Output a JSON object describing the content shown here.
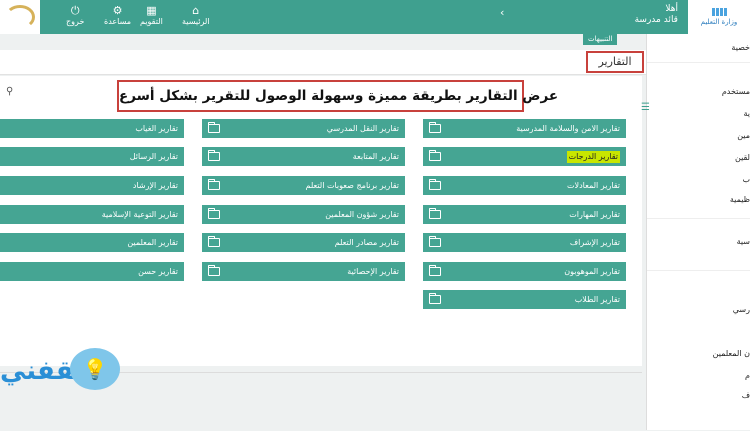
{
  "header": {
    "greeting": "أهلا",
    "user_role": "قائد مدرسة",
    "ministry_logo_text": "وزارة التعليم",
    "nav": [
      {
        "label": "الرئيسية",
        "icon": "home-icon"
      },
      {
        "label": "التقويم",
        "icon": "calendar-icon"
      },
      {
        "label": "مساعدة",
        "icon": "gear-icon"
      },
      {
        "label": "خروج",
        "icon": "power-icon"
      }
    ]
  },
  "notifications_label": "التنبيهات",
  "page_title": "التقارير",
  "banner_text": "عرض التقارير بطريقة مميزة وسهولة الوصول للتقرير بشكل أسرع",
  "sidebar": {
    "items": [
      "خصية",
      "مستخدم",
      "ية",
      "مين",
      "لقين",
      "ب",
      "ظيمية",
      "سية",
      "رسي",
      "ن المعلمين",
      "م",
      "ف"
    ]
  },
  "reports": {
    "col1": [
      "تقارير الامن والسلامة المدرسية",
      "تقارير الدرجات",
      "تقارير المعادلات",
      "تقارير المهارات",
      "تقارير الإشراف",
      "تقارير الموهوبون",
      "تقارير الطلاب"
    ],
    "col2": [
      "تقارير النقل المدرسي",
      "تقارير المتابعة",
      "تقارير برنامج صعوبات التعلم",
      "تقارير شؤون المعلمين",
      "تقارير مصادر التعلم",
      "تقارير الإحصائية"
    ],
    "col3": [
      "تقارير الغياب",
      "تقارير الرسائل",
      "تقارير الإرشاد",
      "تقارير التوعية الإسلامية",
      "تقارير المعلمين",
      "تقارير حسن"
    ]
  },
  "watermark_text": "ثقفني",
  "colors": {
    "header": "#3fa08f",
    "button": "#45a593",
    "highlight": "#c8e600",
    "annotation_border": "#c8413c"
  }
}
